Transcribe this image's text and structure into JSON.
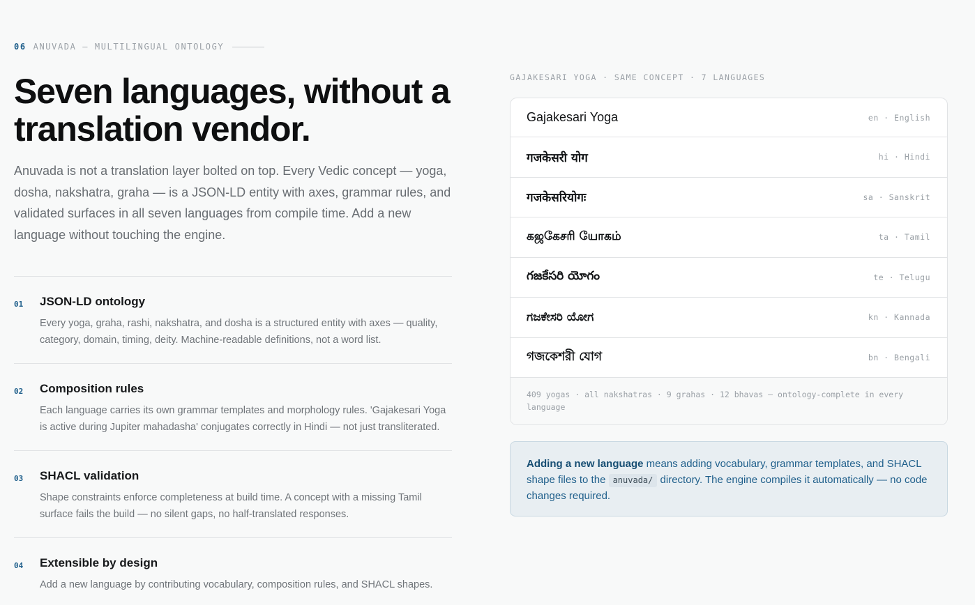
{
  "section": {
    "number": "06",
    "eyebrow": "ANUVADA — MULTILINGUAL ONTOLOGY"
  },
  "headline": "Seven languages, without a translation vendor.",
  "lede": "Anuvada is not a translation layer bolted on top. Every Vedic concept — yoga, dosha, nakshatra, graha — is a JSON-LD entity with axes, grammar rules, and validated surfaces in all seven languages from compile time. Add a new language without touching the engine.",
  "features": [
    {
      "num": "01",
      "title": "JSON-LD ontology",
      "desc": "Every yoga, graha, rashi, nakshatra, and dosha is a structured entity with axes — quality, category, domain, timing, deity. Machine-readable definitions, not a word list."
    },
    {
      "num": "02",
      "title": "Composition rules",
      "desc": "Each language carries its own grammar templates and morphology rules. 'Gajakesari Yoga is active during Jupiter mahadasha' conjugates correctly in Hindi — not just transliterated."
    },
    {
      "num": "03",
      "title": "SHACL validation",
      "desc": "Shape constraints enforce completeness at build time. A concept with a missing Tamil surface fails the build — no silent gaps, no half-translated responses."
    },
    {
      "num": "04",
      "title": "Extensible by design",
      "desc": "Add a new language by contributing vocabulary, composition rules, and SHACL shapes."
    }
  ],
  "card": {
    "label": "GAJAKESARI YOGA · SAME CONCEPT · 7 LANGUAGES",
    "rows": [
      {
        "term": "Gajakesari Yoga",
        "code": "en · English"
      },
      {
        "term": "गजकेसरी योग",
        "code": "hi · Hindi"
      },
      {
        "term": "गजकेसरियोगः",
        "code": "sa · Sanskrit"
      },
      {
        "term": "கஜகேசரி யோகம்",
        "code": "ta · Tamil"
      },
      {
        "term": "గజకేసరి యోగం",
        "code": "te · Telugu"
      },
      {
        "term": "ಗಜಕೇಸರಿ ಯೋಗ",
        "code": "kn · Kannada"
      },
      {
        "term": "গজকেশরী যোগ",
        "code": "bn · Bengali"
      }
    ],
    "footer": "409 yogas · all nakshatras · 9 grahas · 12 bhavas — ontology-complete in every language"
  },
  "callout": {
    "strong": "Adding a new language",
    "text_before": " means adding vocabulary, grammar templates, and SHACL shape files to the ",
    "code": "anuvada/",
    "text_after": " directory. The engine compiles it automatically — no code changes required."
  }
}
